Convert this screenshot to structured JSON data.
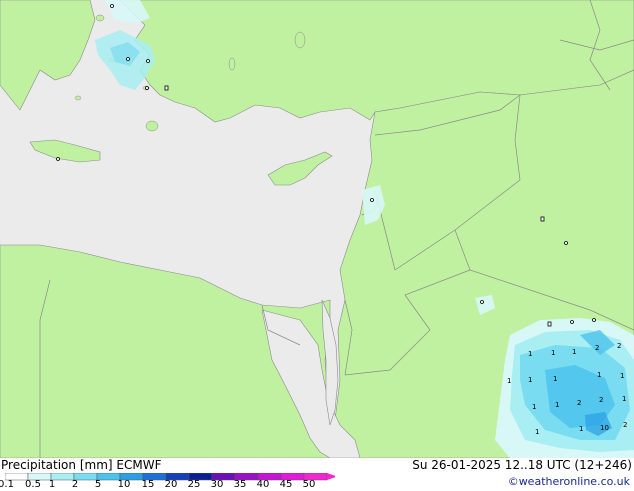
{
  "title": "Precipitation [mm]",
  "model": "ECMWF",
  "datetime": "Su 26-01-2025 12..18 UTC (12+246)",
  "credit": "©weatheronline.co.uk",
  "colors": {
    "sea": "#ebebeb",
    "land": "#c0f1a0",
    "border": "#8a8a8a"
  },
  "colorbar": {
    "ticks": [
      "0.1",
      "0.5",
      "1",
      "2",
      "5",
      "10",
      "15",
      "20",
      "25",
      "30",
      "35",
      "40",
      "45",
      "50"
    ],
    "colors": [
      "#ffffff",
      "#d8f7f7",
      "#a8eef2",
      "#7adcf0",
      "#4cc3ec",
      "#2a9fe4",
      "#1e6fd8",
      "#1540b8",
      "#0c1f96",
      "#6a10b8",
      "#9a12c8",
      "#c414d4",
      "#e01ad8",
      "#f028d0"
    ]
  },
  "precip_values": [
    "1",
    "1",
    "2",
    "2",
    "1",
    "1",
    "1",
    "1",
    "1",
    "1",
    "1",
    "2",
    "2",
    "1",
    "1",
    "1",
    "1",
    "10",
    "2"
  ]
}
